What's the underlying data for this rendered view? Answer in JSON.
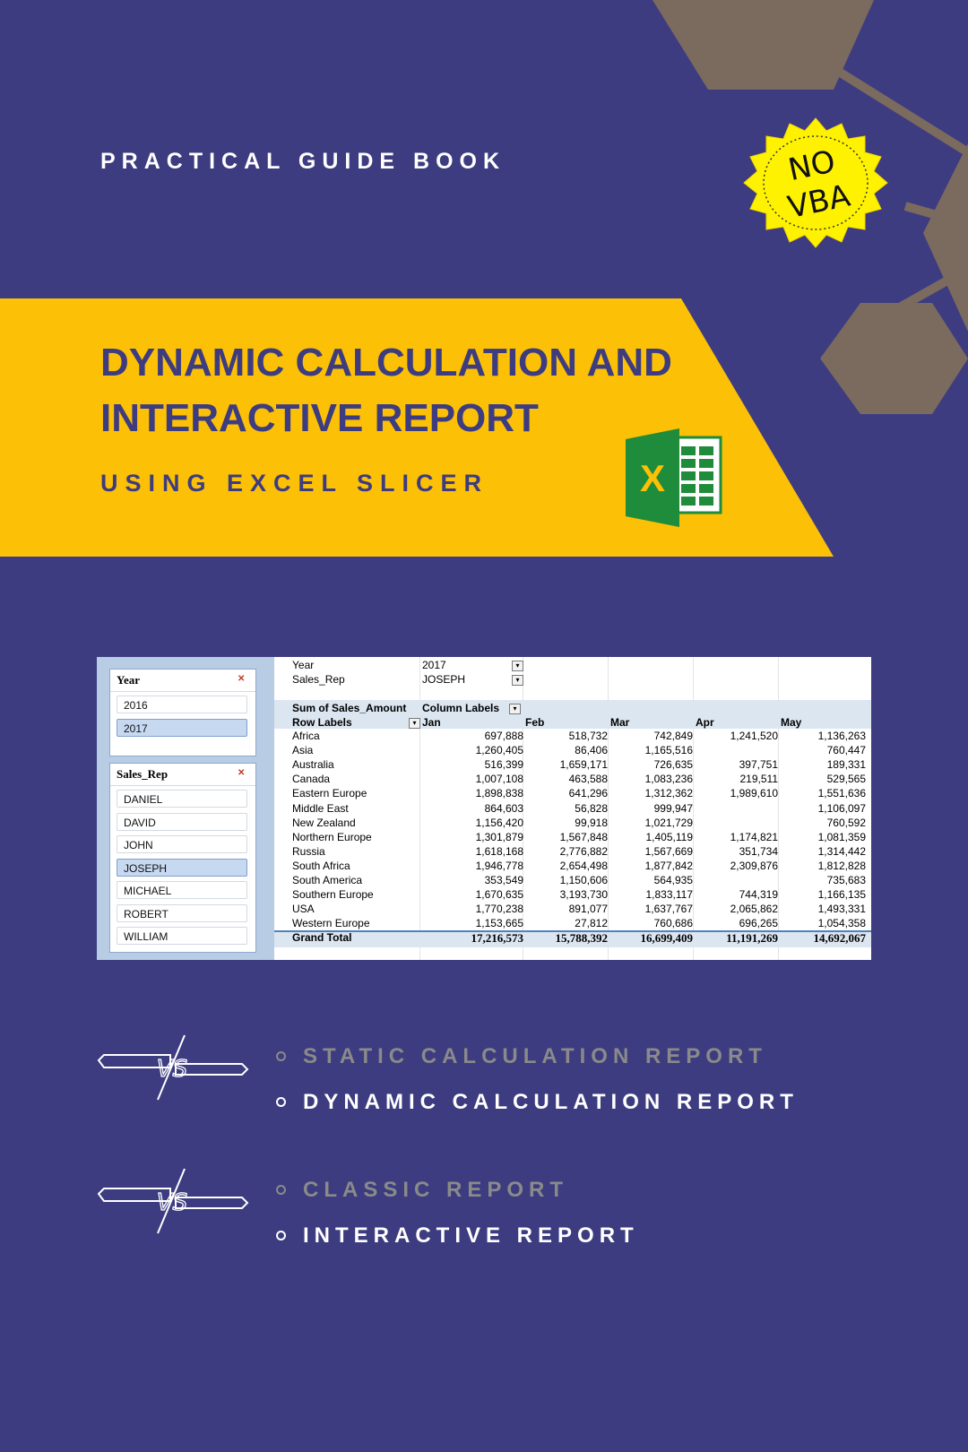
{
  "cover": {
    "top_subtitle": "PRACTICAL GUIDE BOOK",
    "title_line1": "DYNAMIC CALCULATION AND",
    "title_line2": "INTERACTIVE REPORT",
    "banner_subtitle": "USING EXCEL SLICER",
    "seal_line1": "NO",
    "seal_line2": "VBA",
    "excel_letter": "X"
  },
  "colors": {
    "background": "#3d3c80",
    "banner": "#fcc006",
    "title": "#3d3c80",
    "hexagon": "#7b6a5e",
    "seal": "#fff200",
    "excel_green": "#1e8c3a"
  },
  "slicers": {
    "year": {
      "title": "Year",
      "items": [
        "2016",
        "2017"
      ],
      "selected": "2017"
    },
    "sales_rep": {
      "title": "Sales_Rep",
      "items": [
        "DANIEL",
        "DAVID",
        "JOHN",
        "JOSEPH",
        "MICHAEL",
        "ROBERT",
        "WILLIAM"
      ],
      "selected": "JOSEPH"
    }
  },
  "pivot": {
    "filters": [
      {
        "label": "Year",
        "value": "2017"
      },
      {
        "label": "Sales_Rep",
        "value": "JOSEPH"
      }
    ],
    "value_header": "Sum of Sales_Amount",
    "column_labels_header": "Column Labels",
    "row_labels_header": "Row Labels",
    "columns": [
      "Jan",
      "Feb",
      "Mar",
      "Apr",
      "May"
    ],
    "rows": [
      {
        "label": "Africa",
        "values": [
          "697,888",
          "518,732",
          "742,849",
          "1,241,520",
          "1,136,263"
        ]
      },
      {
        "label": "Asia",
        "values": [
          "1,260,405",
          "86,406",
          "1,165,516",
          "",
          "760,447"
        ]
      },
      {
        "label": "Australia",
        "values": [
          "516,399",
          "1,659,171",
          "726,635",
          "397,751",
          "189,331"
        ]
      },
      {
        "label": "Canada",
        "values": [
          "1,007,108",
          "463,588",
          "1,083,236",
          "219,511",
          "529,565"
        ]
      },
      {
        "label": "Eastern Europe",
        "values": [
          "1,898,838",
          "641,296",
          "1,312,362",
          "1,989,610",
          "1,551,636"
        ]
      },
      {
        "label": "Middle East",
        "values": [
          "864,603",
          "56,828",
          "999,947",
          "",
          "1,106,097"
        ]
      },
      {
        "label": "New Zealand",
        "values": [
          "1,156,420",
          "99,918",
          "1,021,729",
          "",
          "760,592"
        ]
      },
      {
        "label": "Northern Europe",
        "values": [
          "1,301,879",
          "1,567,848",
          "1,405,119",
          "1,174,821",
          "1,081,359"
        ]
      },
      {
        "label": "Russia",
        "values": [
          "1,618,168",
          "2,776,882",
          "1,567,669",
          "351,734",
          "1,314,442"
        ]
      },
      {
        "label": "South Africa",
        "values": [
          "1,946,778",
          "2,654,498",
          "1,877,842",
          "2,309,876",
          "1,812,828"
        ]
      },
      {
        "label": "South America",
        "values": [
          "353,549",
          "1,150,606",
          "564,935",
          "",
          "735,683"
        ]
      },
      {
        "label": "Southern Europe",
        "values": [
          "1,670,635",
          "3,193,730",
          "1,833,117",
          "744,319",
          "1,166,135"
        ]
      },
      {
        "label": "USA",
        "values": [
          "1,770,238",
          "891,077",
          "1,637,767",
          "2,065,862",
          "1,493,331"
        ]
      },
      {
        "label": "Western Europe",
        "values": [
          "1,153,665",
          "27,812",
          "760,686",
          "696,265",
          "1,054,358"
        ]
      }
    ],
    "grand_total": {
      "label": "Grand Total",
      "values": [
        "17,216,573",
        "15,788,392",
        "16,699,409",
        "11,191,269",
        "14,692,067"
      ]
    }
  },
  "comparisons": [
    {
      "vs": "VS",
      "old": "STATIC CALCULATION REPORT",
      "new": "DYNAMIC CALCULATION REPORT"
    },
    {
      "vs": "VS",
      "old": "CLASSIC REPORT",
      "new": "INTERACTIVE REPORT"
    }
  ]
}
